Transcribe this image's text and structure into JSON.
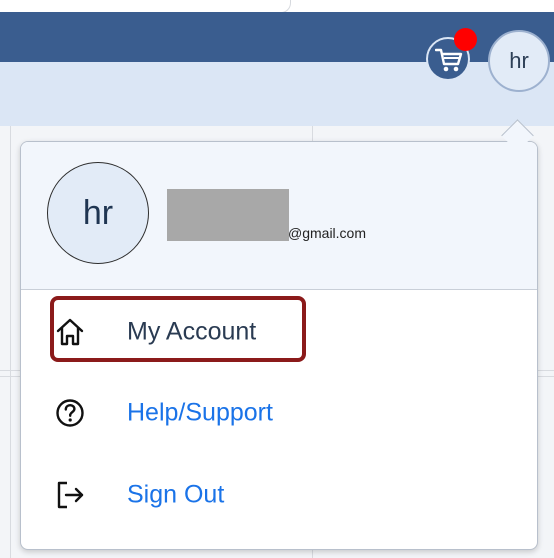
{
  "header": {
    "cart_icon": "cart-icon",
    "cart_badge_color": "#ff0000",
    "avatar_initials": "hr",
    "bar_color": "#3a5d8f"
  },
  "dropdown": {
    "profile": {
      "avatar_initials": "hr",
      "email_domain": "@gmail.com"
    },
    "items": [
      {
        "label": "My Account",
        "icon": "home-icon",
        "color": "#2a3b52"
      },
      {
        "label": "Help/Support",
        "icon": "help-circle-icon",
        "color": "#1a73e8"
      },
      {
        "label": "Sign Out",
        "icon": "sign-out-icon",
        "color": "#1a73e8"
      }
    ],
    "highlight_color": "#8b1a1a"
  }
}
